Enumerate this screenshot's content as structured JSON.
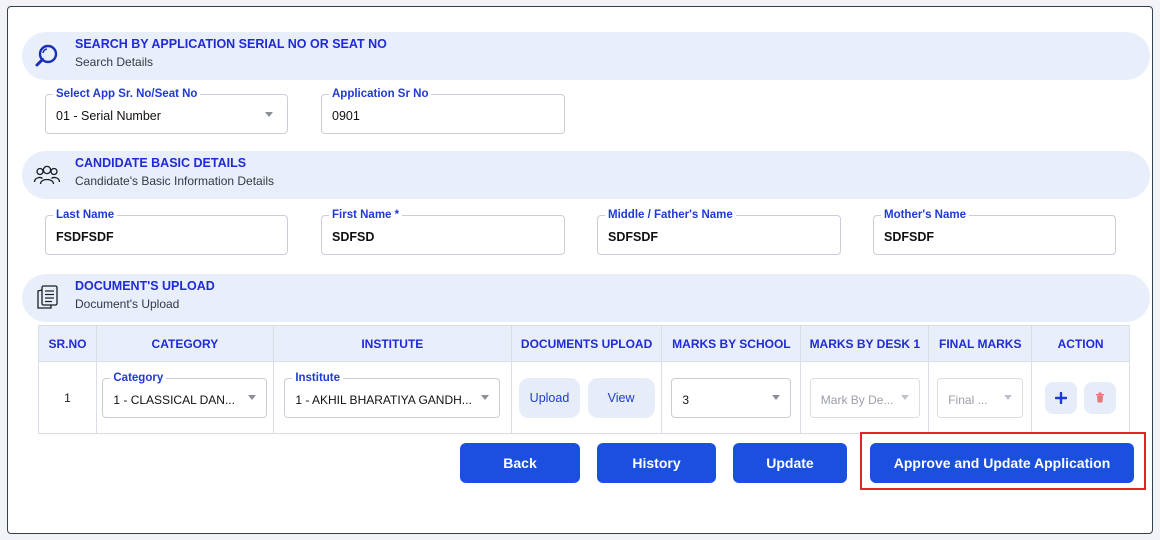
{
  "search_section": {
    "title": "SEARCH BY APPLICATION SERIAL NO OR SEAT NO",
    "subtitle": "Search Details",
    "select_label": "Select App Sr. No/Seat No",
    "select_value": "01 - Serial Number",
    "app_sr_label": "Application Sr No",
    "app_sr_value": "0901"
  },
  "candidate_section": {
    "title": "CANDIDATE BASIC DETAILS",
    "subtitle": "Candidate's Basic Information Details",
    "last_name_label": "Last Name",
    "last_name_value": "FSDFSDF",
    "first_name_label": "First Name *",
    "first_name_value": "SDFSD",
    "middle_name_label": "Middle / Father's Name",
    "middle_name_value": "SDFSDF",
    "mother_name_label": "Mother's Name",
    "mother_name_value": "SDFSDF"
  },
  "documents_section": {
    "title": "DOCUMENT'S UPLOAD",
    "subtitle": "Document's Upload"
  },
  "table": {
    "headers": [
      "SR.NO",
      "CATEGORY",
      "INSTITUTE",
      "DOCUMENTS UPLOAD",
      "MARKS BY SCHOOL",
      "MARKS BY DESK 1",
      "FINAL MARKS",
      "ACTION"
    ],
    "row": {
      "sr_no": "1",
      "category_label": "Category",
      "category_value": "1 - CLASSICAL DAN...",
      "institute_label": "Institute",
      "institute_value": "1 - AKHIL BHARATIYA GANDH...",
      "upload_label": "Upload",
      "view_label": "View",
      "marks_school": "3",
      "marks_desk_placeholder": "Mark By De...",
      "final_marks_placeholder": "Final ..."
    }
  },
  "buttons": {
    "back": "Back",
    "history": "History",
    "update": "Update",
    "approve": "Approve and Update Application"
  },
  "colors": {
    "accent": "#1a4fe0",
    "section_bg": "#e8eefa",
    "heading": "#1f2ad8",
    "highlight": "#e0262a",
    "delete": "#e0262a"
  }
}
